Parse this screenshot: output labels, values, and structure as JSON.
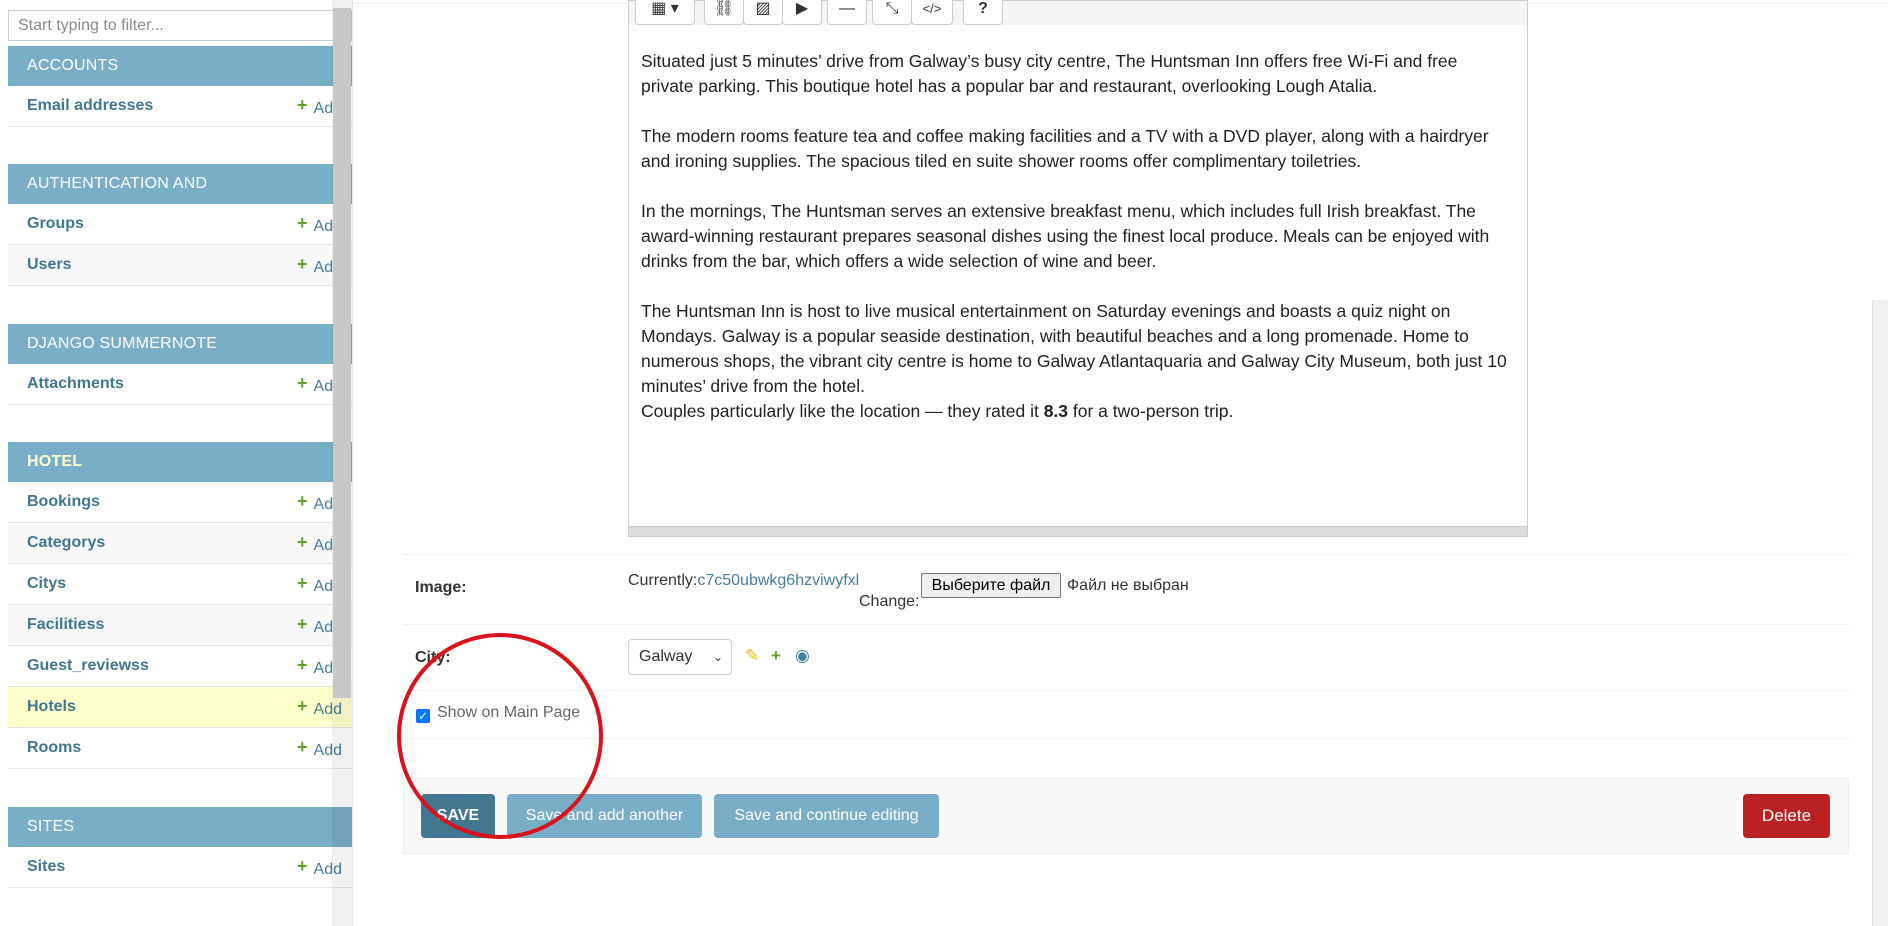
{
  "sidebar": {
    "filter_placeholder": "Start typing to filter...",
    "add_label": "Add",
    "modules": [
      {
        "title": "ACCOUNTS",
        "models": [
          "Email addresses"
        ]
      },
      {
        "title": "AUTHENTICATION AND AUTHORIZATION",
        "models": [
          "Groups",
          "Users"
        ]
      },
      {
        "title": "DJANGO SUMMERNOTE",
        "models": [
          "Attachments"
        ]
      },
      {
        "title": "HOTEL",
        "models": [
          "Bookings",
          "Categorys",
          "Citys",
          "Facilitiess",
          "Guest_reviewss",
          "Hotels",
          "Rooms"
        ]
      },
      {
        "title": "SITES",
        "models": [
          "Sites"
        ]
      }
    ]
  },
  "editor": {
    "toolbar": [
      "table-icon",
      "link-icon",
      "picture-icon",
      "video-icon",
      "hr-icon",
      "fullscreen-icon",
      "code-icon",
      "help-icon"
    ],
    "paragraphs": [
      "Situated just 5 minutes’ drive from Galway’s busy city centre, The Huntsman Inn offers free Wi-Fi and free private parking. This boutique hotel has a popular bar and restaurant, overlooking Lough Atalia.",
      "The modern rooms feature tea and coffee making facilities and a TV with a DVD player, along with a hairdryer and ironing supplies. The spacious tiled en suite shower rooms offer complimentary toiletries.",
      "In the mornings, The Huntsman serves an extensive breakfast menu, which includes full Irish breakfast. The award-winning restaurant prepares seasonal dishes using the finest local produce. Meals can be enjoyed with drinks from the bar, which offers a wide selection of wine and beer.",
      "The Huntsman Inn is host to live musical entertainment on Saturday evenings and boasts a quiz night on Mondays. Galway is a popular seaside destination, with beautiful beaches and a long promenade. Home to numerous shops, the vibrant city centre is home to Galway Atlantaquaria and Galway City Museum, both just 10 minutes’ drive from the hotel."
    ],
    "rating_prefix": "Couples particularly like the location — they rated it ",
    "rating_value": "8.3",
    "rating_suffix": " for a two-person trip."
  },
  "form": {
    "image_label": "Image:",
    "image_currently": "Currently:",
    "image_filename": "c7c50ubwkg6hzviwyfxl",
    "image_change": "Change:",
    "file_button": "Выберите файл",
    "file_status": "Файл не выбран",
    "city_label": "City:",
    "city_value": "Galway",
    "show_main_label": "Show on Main Page",
    "show_main_checked": true
  },
  "submit": {
    "save": "SAVE",
    "save_add": "Save and add another",
    "save_continue": "Save and continue editing",
    "delete": "Delete"
  },
  "colors": {
    "module_header": "#79aec8",
    "link": "#447e9b",
    "add_plus": "#5fa225",
    "delete": "#ba2121",
    "annotation_circle": "#d8131b"
  }
}
